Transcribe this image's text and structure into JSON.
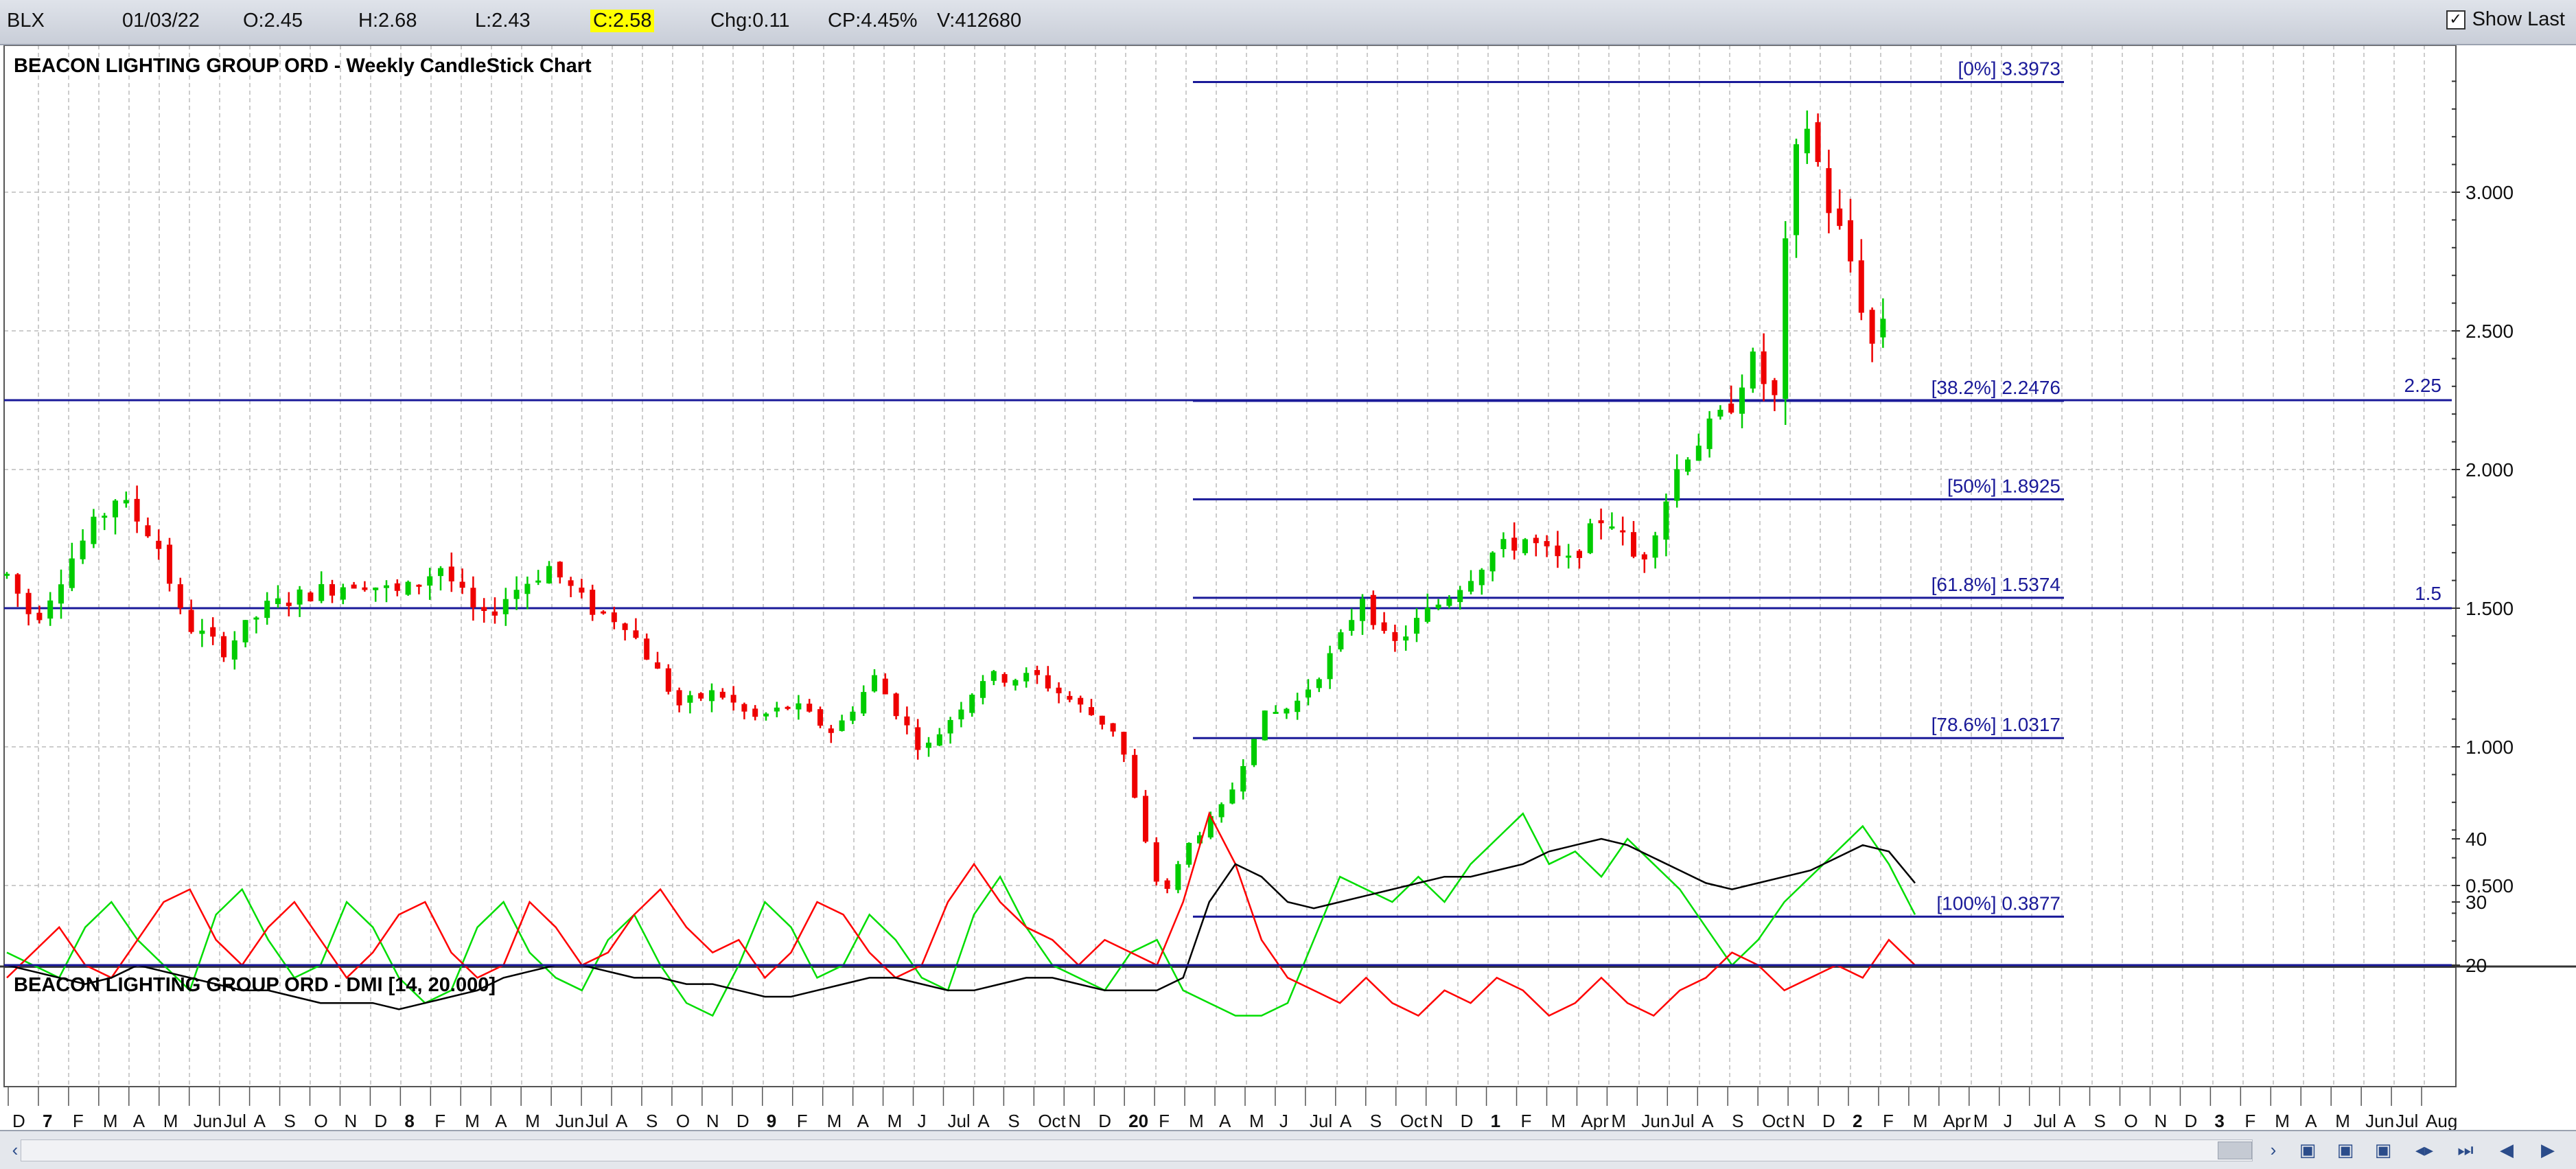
{
  "toolbar": {
    "symbol": "BLX",
    "date": "01/03/22",
    "open": "O:2.45",
    "high": "H:2.68",
    "low": "L:2.43",
    "close": "C:2.58",
    "change": "Chg:0.11",
    "change_pct": "CP:4.45%",
    "volume": "V:412680",
    "show_last_label": "Show Last",
    "show_last_checked": true
  },
  "chart_data": [
    {
      "type": "candlestick",
      "title": "BEACON LIGHTING GROUP ORD - Weekly CandleStick Chart",
      "ylim": [
        0.3,
        3.45
      ],
      "y_ticks": [
        "0.500",
        "1.000",
        "1.500",
        "2.000",
        "2.500",
        "3.000"
      ],
      "y_tick_values": [
        0.5,
        1.0,
        1.5,
        2.0,
        2.5,
        3.0
      ],
      "colors": {
        "up": "#00cc00",
        "down": "#ee0000",
        "lines": "#1a1a99",
        "grid": "#bbbbbb"
      },
      "price_path": [
        [
          0,
          1.62
        ],
        [
          10,
          1.45
        ],
        [
          25,
          1.7
        ],
        [
          40,
          1.9
        ],
        [
          55,
          1.75
        ],
        [
          65,
          1.45
        ],
        [
          80,
          1.35
        ],
        [
          95,
          1.5
        ],
        [
          110,
          1.55
        ],
        [
          130,
          1.6
        ],
        [
          145,
          1.55
        ],
        [
          160,
          1.65
        ],
        [
          175,
          1.45
        ],
        [
          185,
          1.55
        ],
        [
          200,
          1.65
        ],
        [
          215,
          1.5
        ],
        [
          228,
          1.45
        ],
        [
          238,
          1.3
        ],
        [
          248,
          1.15
        ],
        [
          262,
          1.2
        ],
        [
          275,
          1.1
        ],
        [
          290,
          1.15
        ],
        [
          305,
          1.05
        ],
        [
          320,
          1.25
        ],
        [
          338,
          0.98
        ],
        [
          360,
          1.25
        ],
        [
          380,
          1.25
        ],
        [
          395,
          1.15
        ],
        [
          410,
          1.05
        ],
        [
          420,
          0.65
        ],
        [
          426,
          0.45
        ],
        [
          436,
          0.65
        ],
        [
          450,
          0.8
        ],
        [
          462,
          1.1
        ],
        [
          475,
          1.15
        ],
        [
          490,
          1.35
        ],
        [
          500,
          1.55
        ],
        [
          510,
          1.35
        ],
        [
          520,
          1.45
        ],
        [
          532,
          1.55
        ],
        [
          548,
          1.7
        ],
        [
          560,
          1.75
        ],
        [
          575,
          1.65
        ],
        [
          590,
          1.85
        ],
        [
          602,
          1.65
        ],
        [
          618,
          2.05
        ],
        [
          634,
          2.2
        ],
        [
          643,
          2.4
        ],
        [
          652,
          2.25
        ],
        [
          658,
          3.05
        ],
        [
          664,
          3.25
        ],
        [
          672,
          2.95
        ],
        [
          680,
          2.75
        ],
        [
          688,
          2.45
        ],
        [
          693,
          2.58
        ]
      ],
      "fibonacci_levels": [
        {
          "label": "[0%] 3.3973",
          "value": 3.3973
        },
        {
          "label": "[38.2%] 2.2476",
          "value": 2.2476
        },
        {
          "label": "[50%] 1.8925",
          "value": 1.8925
        },
        {
          "label": "[61.8%] 1.5374",
          "value": 1.5374
        },
        {
          "label": "[78.6%] 1.0317",
          "value": 1.0317
        },
        {
          "label": "[100%] 0.3877",
          "value": 0.3877
        }
      ],
      "horizontal_lines": [
        {
          "label": "2.25",
          "value": 2.25
        },
        {
          "label": "1.5",
          "value": 1.5
        }
      ]
    },
    {
      "type": "line",
      "title": "BEACON LIGHTING GROUP ORD - DMI [14, 20.000]",
      "ylim": [
        11,
        48
      ],
      "y_ticks": [
        "20",
        "30",
        "40"
      ],
      "y_tick_values": [
        20,
        30,
        40
      ],
      "threshold": 20,
      "series": [
        {
          "color": "#00dd00",
          "values": [
            22,
            20,
            18,
            26,
            30,
            24,
            20,
            16,
            28,
            32,
            24,
            18,
            20,
            30,
            26,
            18,
            14,
            16,
            26,
            30,
            22,
            18,
            16,
            24,
            28,
            20,
            14,
            12,
            20,
            30,
            26,
            18,
            20,
            28,
            24,
            18,
            16,
            28,
            34,
            26,
            20,
            18,
            16,
            22,
            24,
            16,
            14,
            12,
            12,
            14,
            24,
            34,
            32,
            30,
            34,
            30,
            36,
            40,
            44,
            36,
            38,
            34,
            40,
            36,
            32,
            26,
            20,
            24,
            30,
            34,
            38,
            42,
            36,
            28
          ]
        },
        {
          "color": "#ff0000",
          "values": [
            18,
            22,
            26,
            20,
            18,
            24,
            30,
            32,
            24,
            20,
            26,
            30,
            24,
            18,
            22,
            28,
            30,
            22,
            18,
            20,
            30,
            26,
            20,
            22,
            28,
            32,
            26,
            22,
            24,
            18,
            22,
            30,
            28,
            22,
            18,
            20,
            30,
            36,
            30,
            26,
            24,
            20,
            24,
            22,
            20,
            30,
            44,
            36,
            24,
            18,
            16,
            14,
            18,
            14,
            12,
            16,
            14,
            18,
            16,
            12,
            14,
            18,
            14,
            12,
            16,
            18,
            22,
            20,
            16,
            18,
            20,
            18,
            24,
            20
          ]
        },
        {
          "color": "#000000",
          "values": [
            20,
            19,
            18,
            17,
            18,
            20,
            19,
            18,
            17,
            16,
            16,
            15,
            14,
            14,
            14,
            13,
            14,
            15,
            16,
            18,
            19,
            20,
            20,
            19,
            18,
            18,
            17,
            17,
            16,
            15,
            15,
            16,
            17,
            18,
            18,
            17,
            16,
            16,
            17,
            18,
            18,
            17,
            16,
            16,
            16,
            18,
            30,
            36,
            34,
            30,
            29,
            30,
            31,
            32,
            33,
            34,
            34,
            35,
            36,
            38,
            39,
            40,
            39,
            37,
            35,
            33,
            32,
            33,
            34,
            35,
            37,
            39,
            38,
            33
          ]
        }
      ]
    }
  ],
  "x_axis_labels": [
    "D",
    "7",
    "F",
    "M",
    "A",
    "M",
    "Jun",
    "Jul",
    "A",
    "S",
    "O",
    "N",
    "D",
    "8",
    "F",
    "M",
    "A",
    "M",
    "Jun",
    "Jul",
    "A",
    "S",
    "O",
    "N",
    "D",
    "9",
    "F",
    "M",
    "A",
    "M",
    "J",
    "Jul",
    "A",
    "S",
    "Oct",
    "N",
    "D",
    "20",
    "F",
    "M",
    "A",
    "M",
    "J",
    "Jul",
    "A",
    "S",
    "Oct",
    "N",
    "D",
    "1",
    "F",
    "M",
    "Apr",
    "M",
    "Jun",
    "Jul",
    "A",
    "S",
    "Oct",
    "N",
    "D",
    "2",
    "F",
    "M",
    "Apr",
    "M",
    "J",
    "Jul",
    "A",
    "S",
    "O",
    "N",
    "D",
    "3",
    "F",
    "M",
    "A",
    "M",
    "Jun",
    "Jul",
    "Aug"
  ],
  "x_axis_bold": [
    "7",
    "8",
    "9",
    "20",
    "1",
    "2",
    "3"
  ]
}
